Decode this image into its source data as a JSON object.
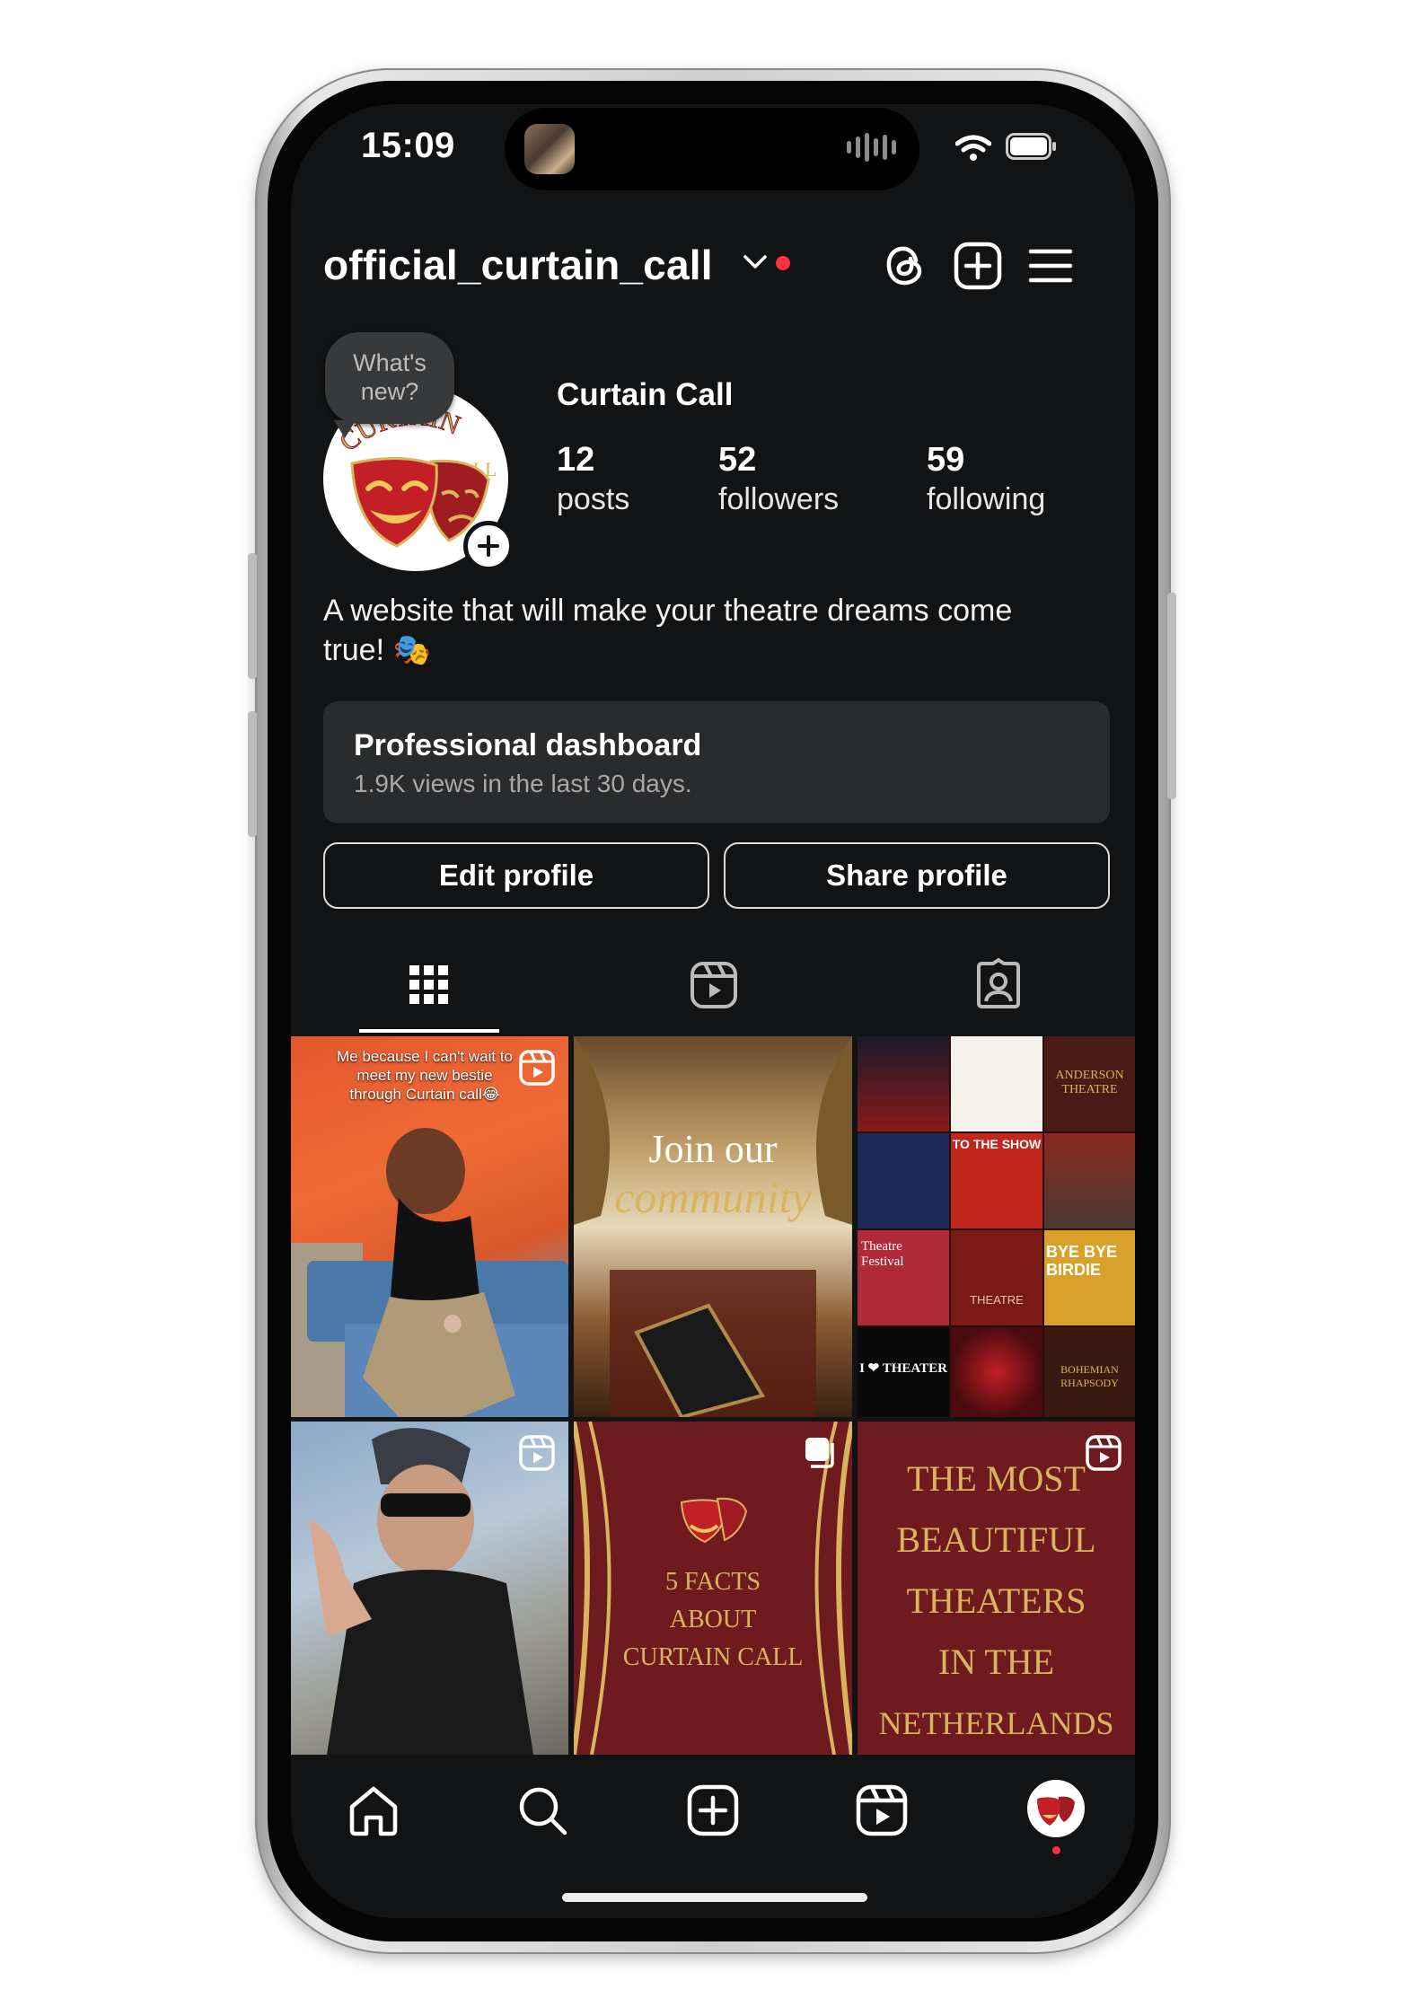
{
  "status_bar": {
    "time": "15:09"
  },
  "header": {
    "username": "official_curtain_call"
  },
  "profile": {
    "new_bubble": [
      "What's",
      "new?"
    ],
    "display_name": "Curtain Call",
    "stats": [
      {
        "value": "12",
        "label": "posts"
      },
      {
        "value": "52",
        "label": "followers"
      },
      {
        "value": "59",
        "label": "following"
      }
    ],
    "bio": "A website that will make your theatre dreams come true! 🎭"
  },
  "dashboard": {
    "title": "Professional dashboard",
    "subtitle": "1.9K views in the last 30 days."
  },
  "actions": {
    "edit": "Edit profile",
    "share": "Share profile"
  },
  "avatar_logo": {
    "line1": "CURTAIN",
    "line2": "CALL"
  },
  "posts": [
    {
      "caption": "Me because I can't wait to meet my new bestie through Curtain call😂",
      "type": "reel"
    },
    {
      "line1": "Join our",
      "line2": "community",
      "type": "image"
    },
    {
      "collage": [
        "TO THE SHOW",
        "Theatre Festival",
        "THEATRE",
        "BYE BYE BIRDIE",
        "I ❤ THEATER",
        "BOHEMIAN RHAPSODY",
        "ANDERSON THEATRE"
      ],
      "type": "image"
    },
    {
      "type": "reel"
    },
    {
      "lines": [
        "5 FACTS",
        "ABOUT",
        "CURTAIN CALL"
      ],
      "type": "carousel"
    },
    {
      "lines": [
        "THE MOST",
        "BEAUTIFUL",
        "THEATERS",
        "IN THE",
        "NETHERLANDS"
      ],
      "type": "reel"
    }
  ],
  "colors": {
    "background": "#121314",
    "accent_red": "#ff3040",
    "brand_maroon": "#7a1f24",
    "gold": "#d9b45c"
  }
}
